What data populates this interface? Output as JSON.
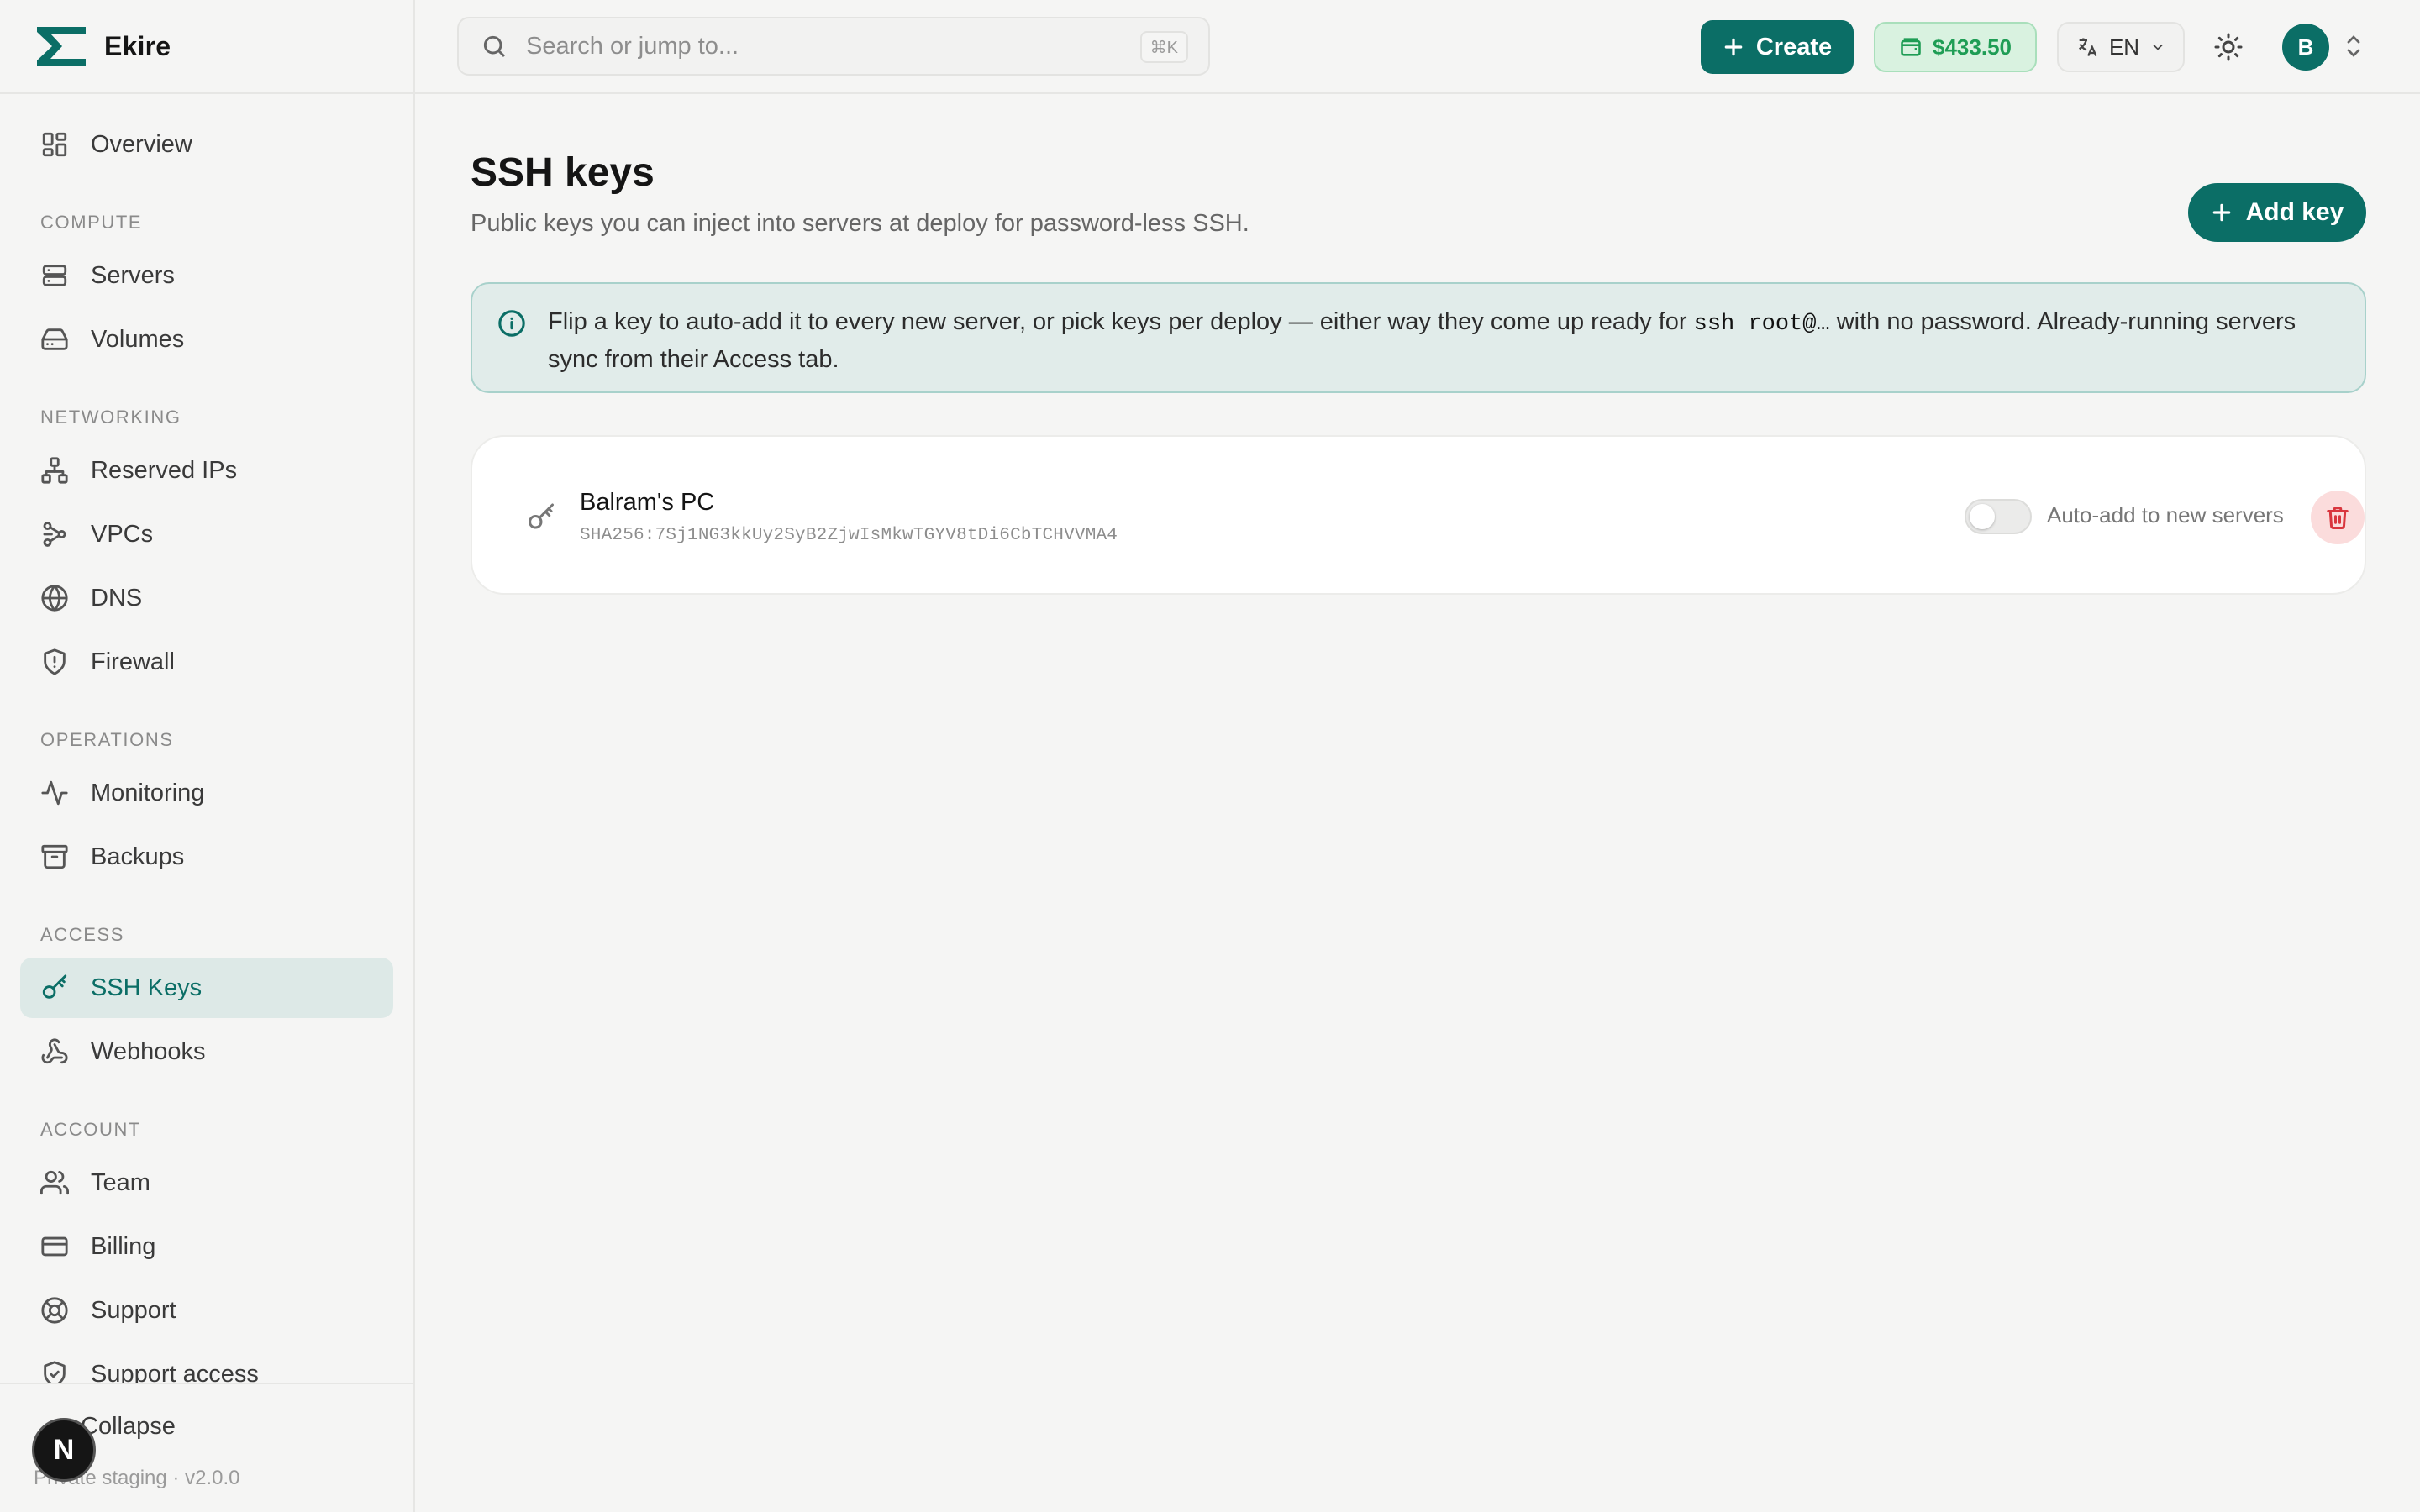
{
  "brand": {
    "name": "Ekire",
    "accent": "#0b6e66"
  },
  "nav": {
    "overview": "Overview",
    "sections": {
      "compute": "COMPUTE",
      "networking": "NETWORKING",
      "operations": "OPERATIONS",
      "access": "ACCESS",
      "account": "ACCOUNT"
    },
    "items": {
      "servers": "Servers",
      "volumes": "Volumes",
      "reserved_ips": "Reserved IPs",
      "vpcs": "VPCs",
      "dns": "DNS",
      "firewall": "Firewall",
      "monitoring": "Monitoring",
      "backups": "Backups",
      "ssh_keys": "SSH Keys",
      "webhooks": "Webhooks",
      "team": "Team",
      "billing": "Billing",
      "support": "Support",
      "support_access": "Support access"
    },
    "active": "ssh_keys"
  },
  "footer": {
    "collapse": "Collapse",
    "version": "Private staging · v2.0.0",
    "badge": "N"
  },
  "topbar": {
    "search_placeholder": "Search or jump to...",
    "search_shortcut": "⌘K",
    "create_label": "Create",
    "balance": "$433.50",
    "language": "EN",
    "avatar_initial": "B"
  },
  "page": {
    "title": "SSH keys",
    "subtitle": "Public keys you can inject into servers at deploy for password-less SSH.",
    "add_key_label": "Add key",
    "info": {
      "before": "Flip a key to auto-add it to every new server, or pick keys per deploy — either way they come up ready for ",
      "code": "ssh root@…",
      "after": " with no password. Already-running servers sync from their Access tab."
    }
  },
  "keys": [
    {
      "name": "Balram's PC",
      "fingerprint": "SHA256:7Sj1NG3kkUy2SyB2ZjwIsMkwTGYV8tDi6CbTCHVVMA4",
      "auto_add_label": "Auto-add to new servers",
      "auto_add": false
    }
  ]
}
